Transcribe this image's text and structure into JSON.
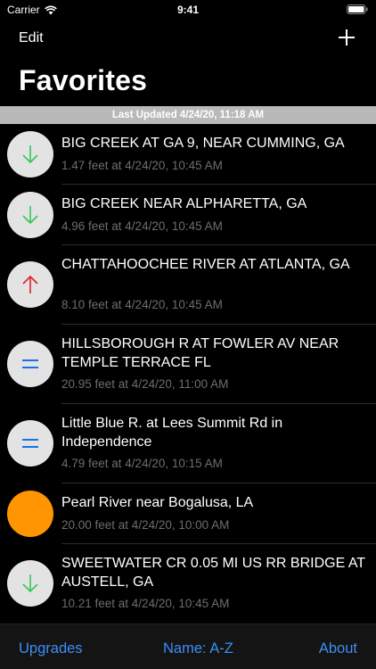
{
  "status_bar": {
    "carrier": "Carrier",
    "time": "9:41"
  },
  "nav": {
    "edit_label": "Edit",
    "add_icon": "plus-icon",
    "title": "Favorites"
  },
  "banner": {
    "text": "Last Updated 4/24/20, 11:18 AM"
  },
  "gauges": [
    {
      "title": "BIG CREEK AT GA 9, NEAR CUMMING, GA",
      "reading": "1.47 feet at 4/24/20, 10:45 AM",
      "trend": "down"
    },
    {
      "title": "BIG CREEK NEAR ALPHARETTA, GA",
      "reading": "4.96 feet at 4/24/20, 10:45 AM",
      "trend": "down"
    },
    {
      "title": "CHATTAHOOCHEE RIVER AT ATLANTA, GA",
      "reading": "8.10 feet at 4/24/20, 10:45 AM",
      "trend": "up"
    },
    {
      "title": "HILLSBOROUGH R AT FOWLER AV NEAR TEMPLE TERRACE FL",
      "reading": "20.95 feet at 4/24/20, 11:00 AM",
      "trend": "steady"
    },
    {
      "title": "Little Blue R. at Lees Summit Rd in Independence",
      "reading": "4.79 feet at 4/24/20, 10:15 AM",
      "trend": "steady"
    },
    {
      "title": "Pearl River near Bogalusa, LA",
      "reading": "20.00 feet at 4/24/20, 10:00 AM",
      "trend": "flood"
    },
    {
      "title": "SWEETWATER CR 0.05 MI US RR BRIDGE AT AUSTELL, GA",
      "reading": "10.21 feet at 4/24/20, 10:45 AM",
      "trend": "down"
    }
  ],
  "tabs": {
    "upgrades": "Upgrades",
    "sort": "Name: A-Z",
    "about": "About"
  },
  "colors": {
    "accent": "#3d8ef7",
    "down": "#34c759",
    "up": "#e0212e",
    "steady": "#1d6fe8",
    "flood": "#ff9500",
    "banner": "#b9b9b9"
  }
}
